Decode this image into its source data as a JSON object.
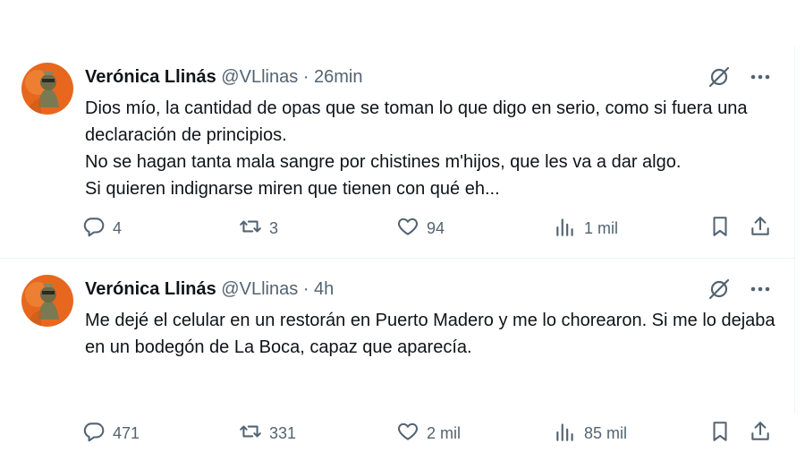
{
  "tweets": [
    {
      "name": "Verónica Llinás",
      "handle": "@VLlinas",
      "separator": "·",
      "time": "26min",
      "lines": [
        "Dios mío, la cantidad de opas que se toman lo que digo en serio, como si fuera una declaración de principios.",
        "No se hagan tanta mala sangre por chistines m'hijos, que les va a dar algo.",
        "Si quieren indignarse miren que tienen con qué eh..."
      ],
      "replies": "4",
      "retweets": "3",
      "likes": "94",
      "views": "1 mil"
    },
    {
      "name": "Verónica Llinás",
      "handle": "@VLlinas",
      "separator": "·",
      "time": "4h",
      "lines": [
        "Me dejé el celular en un restorán en Puerto Madero y me lo chorearon. Si me lo dejaba en un bodegón de La Boca, capaz que aparecía."
      ],
      "replies": "471",
      "retweets": "331",
      "likes": "2 mil",
      "views": "85 mil"
    }
  ],
  "icons": {
    "grok": "grok-icon",
    "more": "more-icon",
    "reply": "reply-icon",
    "retweet": "retweet-icon",
    "like": "heart-icon",
    "views": "views-icon",
    "bookmark": "bookmark-icon",
    "share": "share-icon"
  },
  "colors": {
    "text": "#0f1419",
    "secondary": "#536471",
    "divider": "#eff3f4",
    "avatar_bg": "#e8671f"
  }
}
